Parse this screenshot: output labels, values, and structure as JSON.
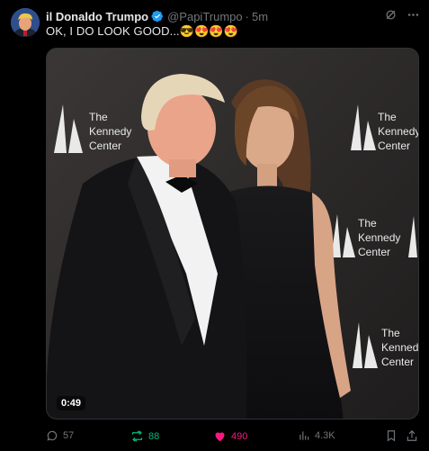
{
  "author": {
    "name": "il Donaldo Trumpo",
    "handle": "@PapiTrumpo",
    "separator": "·",
    "time": "5m"
  },
  "tweet_text": "OK, I DO LOOK GOOD...😎😍😍😍",
  "media": {
    "duration": "0:49",
    "backdrop_logo_line1": "The",
    "backdrop_logo_line2": "Kennedy",
    "backdrop_logo_line3": "Center"
  },
  "actions": {
    "replies": "57",
    "reposts": "88",
    "likes": "490",
    "views": "4.3K"
  },
  "colors": {
    "background": "#000000",
    "text_primary": "#e7e9ea",
    "text_secondary": "#71767b",
    "verified": "#1d9bf0",
    "repost_active": "#00ba7c",
    "like_active": "#f91880"
  },
  "icons": [
    "verified-badge-icon",
    "grok-icon",
    "more-icon",
    "reply-icon",
    "repost-icon",
    "like-icon",
    "views-icon",
    "bookmark-icon",
    "share-icon"
  ]
}
